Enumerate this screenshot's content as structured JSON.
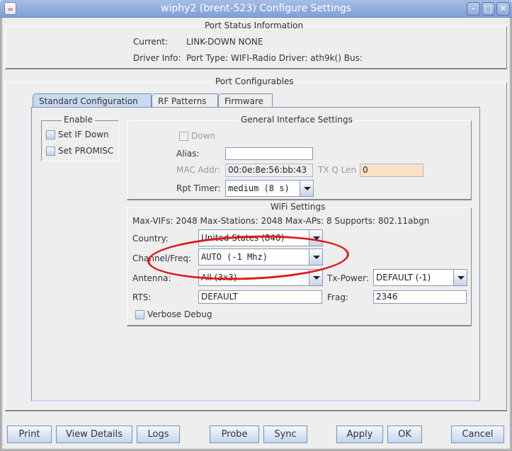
{
  "window": {
    "title": "wiphy2  (brent-523) Configure Settings",
    "icons": {
      "app": "java-icon",
      "minimize": "minimize-icon",
      "maximize": "maximize-icon",
      "close": "close-icon"
    }
  },
  "port_status": {
    "title": "Port Status Information",
    "current_label": "Current:",
    "current_value": "LINK-DOWN  NONE",
    "driver_label": "Driver Info:",
    "driver_value": "Port Type: WIFI-Radio   Driver: ath9k()  Bus:"
  },
  "configurables": {
    "title": "Port Configurables",
    "tabs": [
      {
        "label": "Standard Configuration",
        "active": true
      },
      {
        "label": "RF Patterns",
        "active": false
      },
      {
        "label": "Firmware",
        "active": false
      }
    ]
  },
  "enable": {
    "title": "Enable",
    "set_if_down": {
      "label": "Set IF Down",
      "checked": false
    },
    "set_promisc": {
      "label": "Set PROMISC",
      "checked": false
    }
  },
  "general": {
    "title": "General Interface Settings",
    "down": {
      "label": "Down",
      "checked": false,
      "enabled": false
    },
    "alias_label": "Alias:",
    "alias_value": "",
    "mac_label": "MAC Addr:",
    "mac_value": "00:0e:8e:56:bb:43",
    "txq_label": "TX Q Len",
    "txq_value": "0",
    "rpt_label": "Rpt Timer:",
    "rpt_value": "medium   (8 s)"
  },
  "wifi": {
    "title": "WiFi Settings",
    "caps": "Max-VIFs: 2048  Max-Stations: 2048  Max-APs: 8  Supports: 802.11abgn",
    "country_label": "Country:",
    "country_value": "United States (840)",
    "channel_label": "Channel/Freq:",
    "channel_value": "AUTO (-1 Mhz)",
    "antenna_label": "Antenna:",
    "antenna_value": "All (3x3)",
    "txpower_label": "Tx-Power:",
    "txpower_value": "DEFAULT  (-1)",
    "rts_label": "RTS:",
    "rts_value": "DEFAULT",
    "frag_label": "Frag:",
    "frag_value": "2346",
    "verbose": {
      "label": "Verbose Debug",
      "checked": false
    }
  },
  "annotation": {
    "highlight_color": "#e01818",
    "highlighted_field": "Channel/Freq"
  },
  "buttons": {
    "print": "Print",
    "view_details": "View Details",
    "logs": "Logs",
    "probe": "Probe",
    "sync": "Sync",
    "apply": "Apply",
    "ok": "OK",
    "cancel": "Cancel"
  }
}
